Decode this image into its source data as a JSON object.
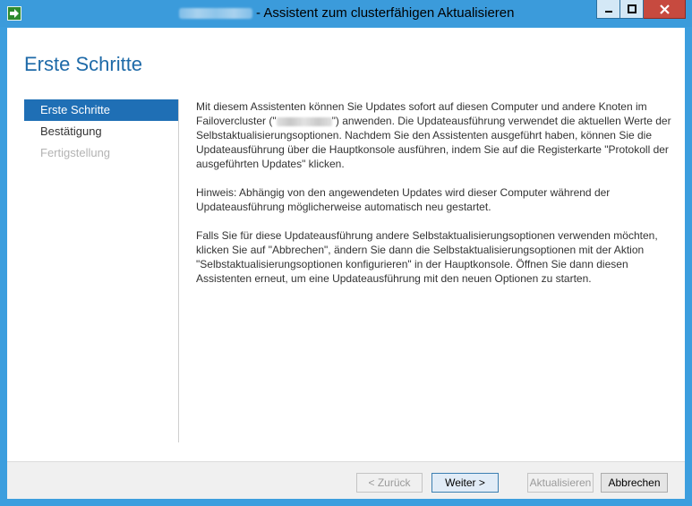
{
  "window": {
    "title": "- Assistent zum clusterfähigen Aktualisieren",
    "controls": {
      "minimize": "–",
      "maximize": "□",
      "close": "✕"
    }
  },
  "page": {
    "title": "Erste Schritte"
  },
  "nav": {
    "items": [
      {
        "label": "Erste Schritte",
        "state": "active"
      },
      {
        "label": "Bestätigung",
        "state": "normal"
      },
      {
        "label": "Fertigstellung",
        "state": "disabled"
      }
    ]
  },
  "content": {
    "p1_a": "Mit diesem Assistenten können Sie Updates sofort auf diesen Computer und andere Knoten im Failovercluster (\"",
    "p1_b": "\") anwenden. Die Updateausführung verwendet die aktuellen Werte der Selbstaktualisierungsoptionen. Nachdem Sie den Assistenten ausgeführt haben, können Sie die Updateausführung über die Hauptkonsole ausführen, indem Sie auf die Registerkarte \"Protokoll der ausgeführten Updates\" klicken.",
    "p2": "Hinweis: Abhängig von den angewendeten Updates wird dieser Computer während der Updateausführung möglicherweise automatisch neu gestartet.",
    "p3": "Falls Sie für diese Updateausführung andere Selbstaktualisierungsoptionen verwenden möchten, klicken Sie auf \"Abbrechen\", ändern Sie dann die Selbstaktualisierungsoptionen mit der Aktion \"Selbstaktualisierungsoptionen konfigurieren\" in der Hauptkonsole. Öffnen Sie dann diesen Assistenten erneut, um eine Updateausführung mit den neuen Optionen zu starten."
  },
  "footer": {
    "back_label": "< Zurück",
    "next_label": "Weiter >",
    "update_label": "Aktualisieren",
    "cancel_label": "Abbrechen"
  },
  "colors": {
    "titlebar": "#3b9bdb",
    "accent": "#1f6fb5",
    "page_title": "#1e6aa8",
    "close": "#c74a3f"
  },
  "icons": {
    "app": "arrow-right-icon",
    "minimize": "minimize-icon",
    "maximize": "maximize-icon",
    "close": "close-icon"
  }
}
